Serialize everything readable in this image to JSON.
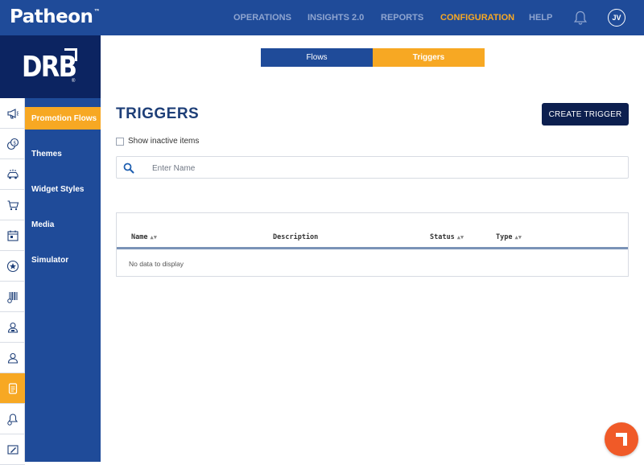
{
  "header": {
    "brand": "Patheon",
    "brand_tm": "™",
    "nav": [
      {
        "label": "OPERATIONS",
        "active": false
      },
      {
        "label": "INSIGHTS 2.0",
        "active": false
      },
      {
        "label": "REPORTS",
        "active": false
      },
      {
        "label": "CONFIGURATION",
        "active": true
      },
      {
        "label": "HELP",
        "active": false
      }
    ],
    "avatar_initials": "JV",
    "bell_icon": "bell-icon"
  },
  "logo": {
    "text": "DRB",
    "reg": "®"
  },
  "rail_icons": [
    "megaphone-icon",
    "coins-icon",
    "car-wash-icon",
    "cart-icon",
    "calendar-icon",
    "star-icon",
    "barcode-settings-icon",
    "user-badge-icon",
    "user-icon",
    "gift-card-icon",
    "bell-settings-icon",
    "edit-screen-icon"
  ],
  "rail_active_index": 9,
  "submenu": {
    "items": [
      {
        "label": "Promotion Flows",
        "active": true
      },
      {
        "label": "Themes",
        "active": false
      },
      {
        "label": "Widget Styles",
        "active": false
      },
      {
        "label": "Media",
        "active": false
      },
      {
        "label": "Simulator",
        "active": false
      }
    ]
  },
  "tabs": {
    "flows": "Flows",
    "triggers": "Triggers",
    "active": "triggers"
  },
  "main": {
    "title": "TRIGGERS",
    "create_button": "CREATE TRIGGER",
    "show_inactive_label": "Show inactive items",
    "show_inactive_checked": false,
    "search": {
      "placeholder": "Enter Name",
      "value": ""
    }
  },
  "table": {
    "columns": [
      {
        "label": "Name",
        "sortable": true
      },
      {
        "label": "Description",
        "sortable": false
      },
      {
        "label": "Status",
        "sortable": true
      },
      {
        "label": "Type",
        "sortable": true
      }
    ],
    "empty_text": "No data to display"
  },
  "colors": {
    "header_blue": "#1f4b99",
    "navy": "#0c2461",
    "accent_orange": "#f7a823",
    "help_orange": "#f05a28"
  }
}
